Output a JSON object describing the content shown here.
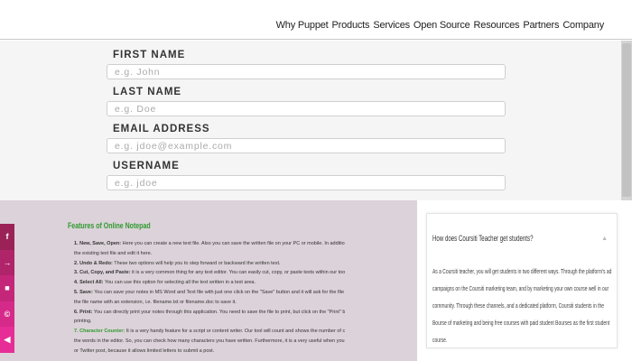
{
  "nav": {
    "items": [
      "Why Puppet",
      "Products",
      "Services",
      "Open Source",
      "Resources",
      "Partners",
      "Company"
    ]
  },
  "form": {
    "first_name": {
      "label": "FIRST NAME",
      "placeholder": "e.g. John"
    },
    "last_name": {
      "label": "LAST NAME",
      "placeholder": "e.g. Doe"
    },
    "email": {
      "label": "EMAIL ADDRESS",
      "placeholder": "e.g. jdoe@example.com"
    },
    "username": {
      "label": "USERNAME",
      "placeholder": "e.g. jdoe"
    }
  },
  "social": {
    "icons": [
      "facebook-icon",
      "twitter-icon",
      "email-icon",
      "whatsapp-icon",
      "telegram-icon"
    ],
    "glyphs": [
      "f",
      "→",
      "■",
      "©",
      "◀"
    ],
    "colors": [
      "#9b2257",
      "#b0246a",
      "#c4277a",
      "#d62a8a",
      "#e62e96"
    ]
  },
  "features": {
    "title": "Features of Online Notepad",
    "items": [
      {
        "lead": "1. New, Save, Open:",
        "text": " Here you can create a new text file. Also you can save the written file on your PC or mobile. In addition, you can open"
      },
      {
        "lead": "",
        "text": "the existing text file and edit it here."
      },
      {
        "lead": "2. Undo & Redo:",
        "text": " These two options will help you to step forward or backward the written text."
      },
      {
        "lead": "3. Cut, Copy, and Paste:",
        "text": " it is a very common thing for any text editor. You can easily cut, copy, or paste texts within our tool."
      },
      {
        "lead": "4. Select All:",
        "text": " You can use this option for selecting all the text written in a text area."
      },
      {
        "lead": "5. Save:",
        "text": " You can save your notes in MS Word and Text file with just one click on the \"Save\" button and it will ask for the file name. So, you can give"
      },
      {
        "lead": "",
        "text": "the file name with an extension, i.e. filename.txt or filename.doc to save it."
      },
      {
        "lead": "6. Print:",
        "text": " You can directly print your notes through this application. You need to save the file to print, but click on the \"Print\" button and start"
      },
      {
        "lead": "",
        "text": "printing."
      },
      {
        "lead": "7. Character Counter:",
        "text": " It is a very handy feature for a script or content writer. Our tool will count and shows the number of characters and"
      },
      {
        "lead": "",
        "text": "the words in the editor. So, you can check how many characters you have written. Furthermore, it is a very useful when you are a Facebook"
      },
      {
        "lead": "",
        "text": "or Twitter post, because it allows limited letters to submit a post."
      }
    ]
  },
  "card": {
    "question": "How does Coursiti Teacher get students?",
    "answer": "As a Coursiti teacher, you will get students in two different ways. Through the platform's ad campaigns on the Coursiti marketing team, and by marketing your own course well in our community. Through these channels, and a dedicated platform, Coursiti students in the Bourse of marketing and being free courses with paid student Bourses as the first student course."
  }
}
